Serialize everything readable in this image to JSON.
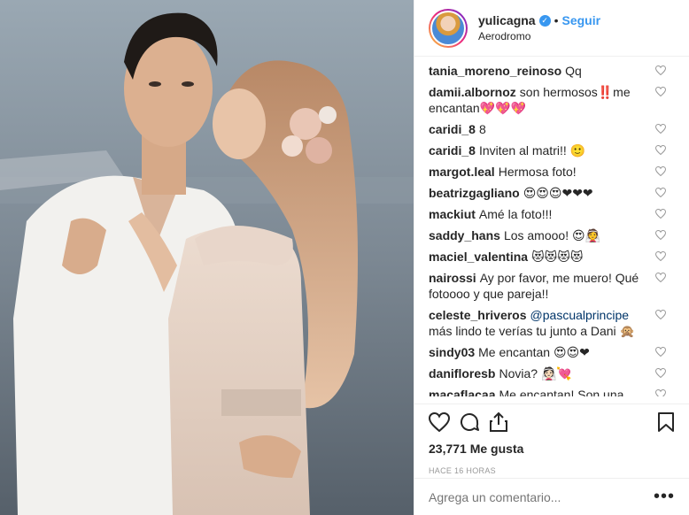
{
  "header": {
    "username": "yulicagna",
    "verified": "✓",
    "dot": "•",
    "follow_label": "Seguir",
    "location": "Aerodromo"
  },
  "comments": [
    {
      "user": "tania_moreno_reinoso",
      "text": "Qq"
    },
    {
      "user": "damii.albornoz",
      "text": "son hermosos‼️me encantan💖💖💖"
    },
    {
      "user": "caridi_8",
      "text": "8"
    },
    {
      "user": "caridi_8",
      "text": "Inviten al matri!! 🙂"
    },
    {
      "user": "margot.leal",
      "text": "Hermosa foto!"
    },
    {
      "user": "beatrizgagliano",
      "text": "😍😍😍❤❤❤"
    },
    {
      "user": "mackiut",
      "text": "Amé la foto!!!"
    },
    {
      "user": "saddy_hans",
      "text": "Los amooo! 😍👰"
    },
    {
      "user": "maciel_valentina",
      "text": "😻😻😻😻"
    },
    {
      "user": "nairossi",
      "text": "Ay por favor, me muero! Qué fotoooo y que pareja!!"
    },
    {
      "user": "celeste_hriveros",
      "mention": "@pascualprincipe",
      "text": "más lindo te verías tu junto a Dani 🙊"
    },
    {
      "user": "sindy03",
      "text": "Me encantan 😍😍❤"
    },
    {
      "user": "danifloresb",
      "text": "Novia? 👰🏻💘"
    },
    {
      "user": "macaflacaa",
      "text": "Me encantan! Son una de"
    }
  ],
  "likes": "23,771 Me gusta",
  "time": "HACE 16 HORAS",
  "add_comment": {
    "placeholder": "Agrega un comentario..."
  },
  "more": "•••",
  "colors": {
    "link": "#3897f0",
    "border": "#efefef",
    "muted": "#999999"
  }
}
